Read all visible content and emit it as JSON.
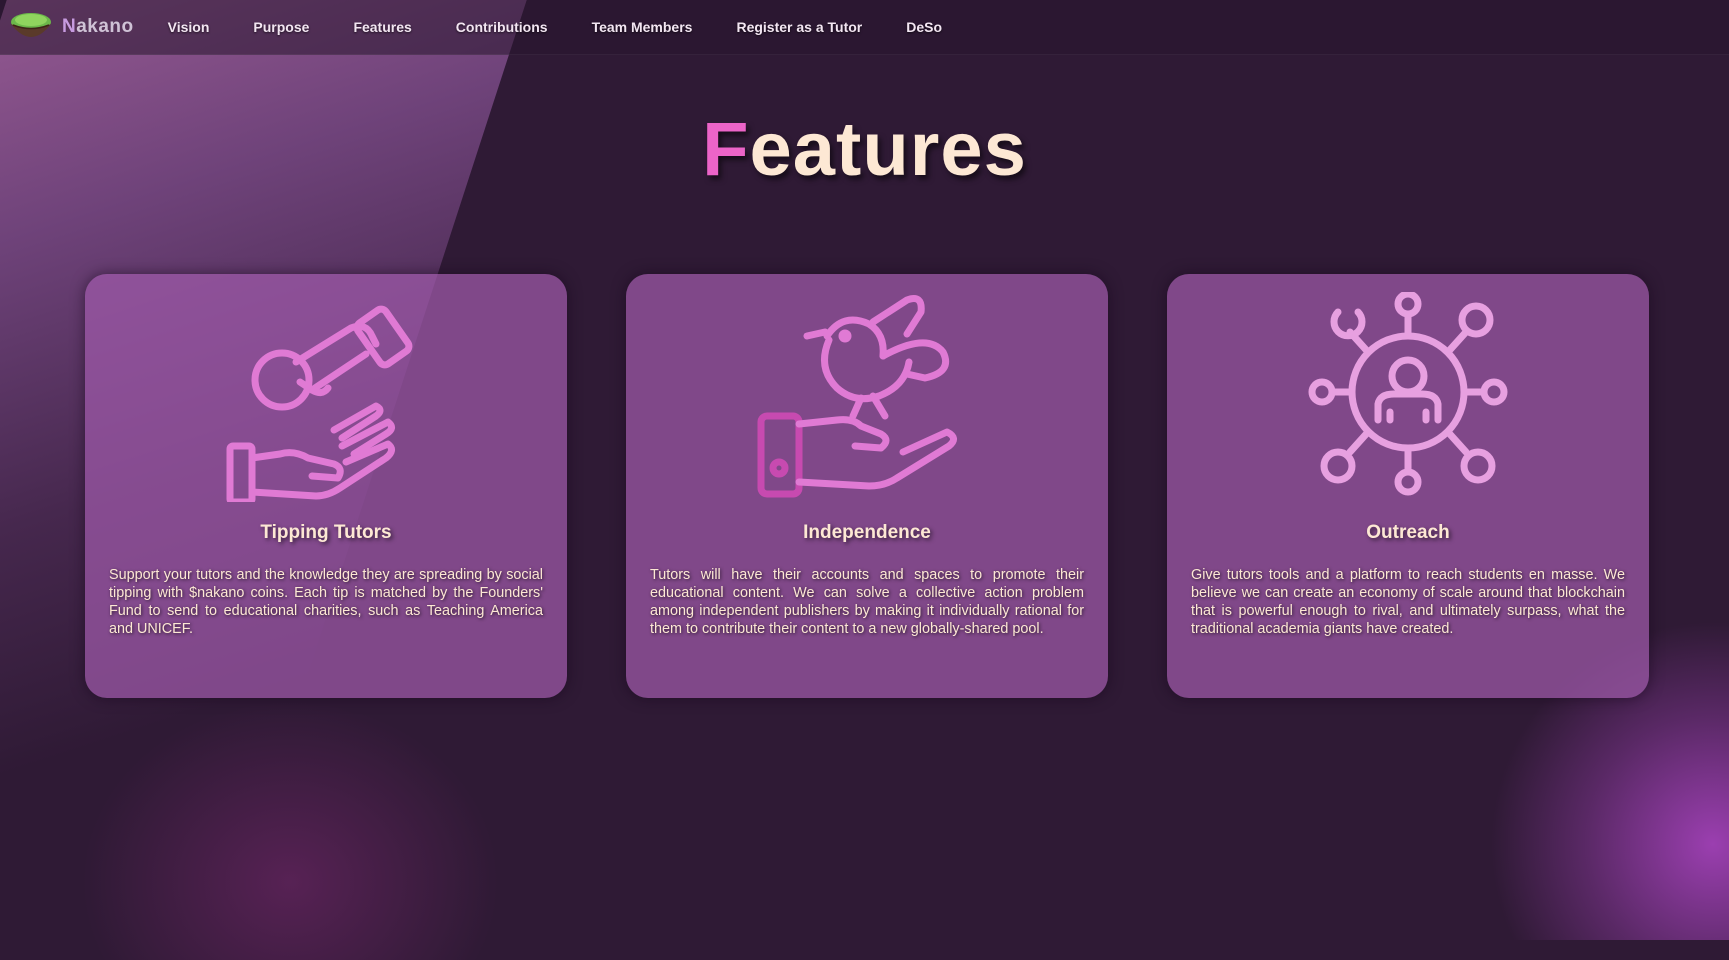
{
  "brand": {
    "first_letter": "N",
    "rest": "akano"
  },
  "nav": {
    "items": [
      "Vision",
      "Purpose",
      "Features",
      "Contributions",
      "Team Members",
      "Register as a Tutor",
      "DeSo"
    ]
  },
  "page": {
    "title_first": "F",
    "title_rest": "eatures"
  },
  "colors": {
    "accent_pink": "#ec64c8",
    "cream": "#fde8d4",
    "card_bg": "#a05aaa",
    "background": "#2f1a35"
  },
  "features": [
    {
      "icon": "hand-coin-tip-icon",
      "title": "Tipping Tutors",
      "text": "Support your tutors and the knowledge they are spreading by social tipping with $nakano coins. Each tip is matched by the Founders' Fund to send to educational charities, such as Teaching America and UNICEF."
    },
    {
      "icon": "hand-bird-icon",
      "title": "Independence",
      "text": "Tutors will have their accounts and spaces to promote their educational content. We can solve a collective action problem among independent publishers by making it individually rational for them to contribute their content to a new globally-shared pool."
    },
    {
      "icon": "user-network-icon",
      "title": "Outreach",
      "text": "Give tutors tools and a platform to reach students en masse. We believe we can create an economy of scale around that blockchain that is powerful enough to rival, and ultimately surpass, what the traditional academia giants have created."
    }
  ]
}
